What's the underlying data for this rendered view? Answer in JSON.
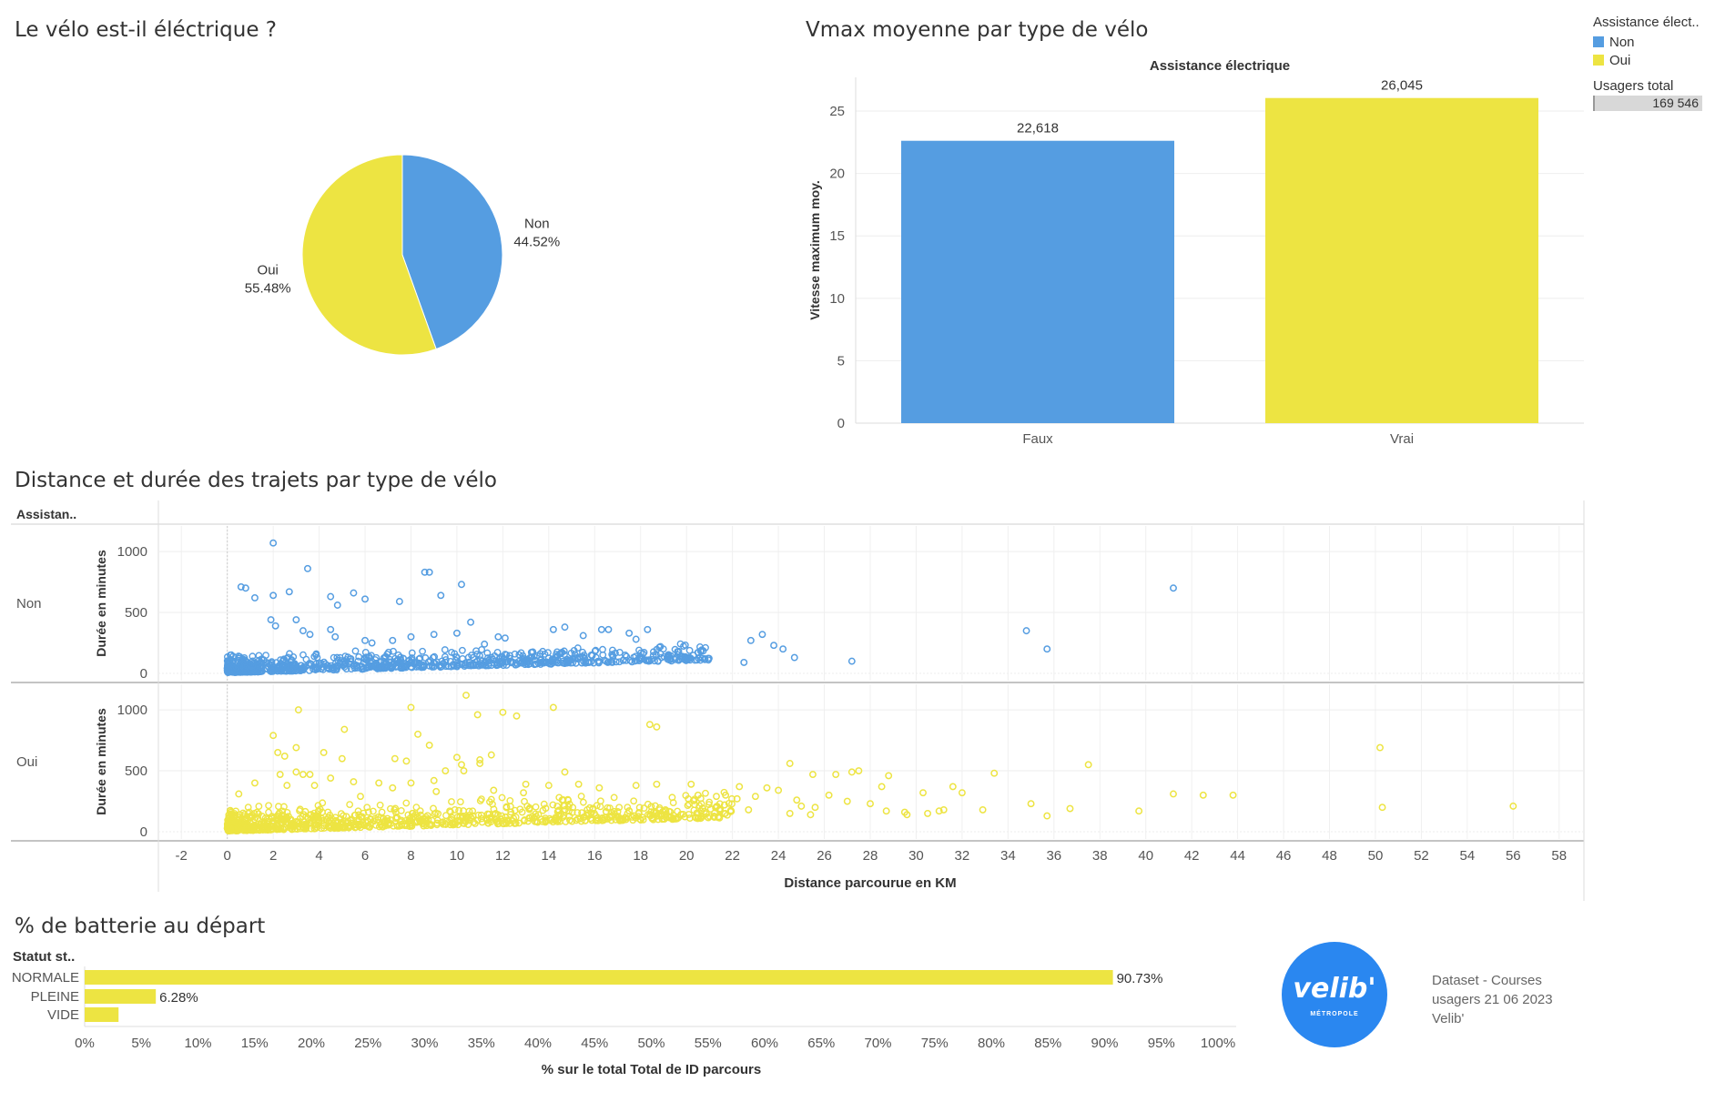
{
  "pie": {
    "title": "Le vélo est-il éléctrique ?",
    "chart_data": {
      "type": "pie",
      "slices": [
        {
          "label": "Non",
          "value": 44.52,
          "value_label": "44.52%",
          "color": "#559de1"
        },
        {
          "label": "Oui",
          "value": 55.48,
          "value_label": "55.48%",
          "color": "#ede442"
        }
      ]
    }
  },
  "vmax": {
    "title": "Vmax moyenne par type de vélo",
    "chart_data": {
      "type": "bar",
      "header": "Assistance électrique",
      "categories": [
        "Faux",
        "Vrai"
      ],
      "values": [
        22.618,
        26.045
      ],
      "value_labels": [
        "22,618",
        "26,045"
      ],
      "colors": [
        "#559de1",
        "#ede442"
      ],
      "ylabel": "Vitesse maximum moy.",
      "yticks": [
        "0",
        "5",
        "10",
        "15",
        "20",
        "25"
      ],
      "ylim": [
        0,
        27.7
      ]
    }
  },
  "legend": {
    "title": "Assistance élect..",
    "items": [
      {
        "label": "Non",
        "color": "#559de1"
      },
      {
        "label": "Oui",
        "color": "#ede442"
      }
    ],
    "total_title": "Usagers total",
    "total_value": "169 546"
  },
  "scatter": {
    "title": "Distance et durée des trajets par type de vélo",
    "chart_data": {
      "type": "scatter",
      "row_header": "Assistan..",
      "xlabel": "Distance parcourue en KM",
      "ylabel": "Durée en minutes",
      "xticks": [
        "-2",
        "0",
        "2",
        "4",
        "6",
        "8",
        "10",
        "12",
        "14",
        "16",
        "18",
        "20",
        "22",
        "24",
        "26",
        "28",
        "30",
        "32",
        "34",
        "36",
        "38",
        "40",
        "42",
        "44",
        "46",
        "48",
        "50",
        "52",
        "54",
        "56",
        "58"
      ],
      "yticks": [
        "0",
        "500",
        "1000"
      ],
      "xlim": [
        -3,
        59
      ],
      "ylim": [
        -30,
        1150
      ],
      "series": [
        {
          "name": "Non",
          "color": "#559de1",
          "points": [
            [
              2,
              1070
            ],
            [
              3.5,
              860
            ],
            [
              8.6,
              830
            ],
            [
              8.8,
              830
            ],
            [
              10.2,
              730
            ],
            [
              0.6,
              710
            ],
            [
              0.8,
              700
            ],
            [
              1.2,
              620
            ],
            [
              2,
              640
            ],
            [
              2.7,
              670
            ],
            [
              4.5,
              630
            ],
            [
              5.5,
              660
            ],
            [
              6,
              610
            ],
            [
              7.5,
              590
            ],
            [
              9.3,
              640
            ],
            [
              4.8,
              560
            ],
            [
              1.9,
              440
            ],
            [
              2.1,
              390
            ],
            [
              3,
              440
            ],
            [
              3.3,
              350
            ],
            [
              3.6,
              320
            ],
            [
              4.5,
              360
            ],
            [
              4.7,
              300
            ],
            [
              6,
              270
            ],
            [
              6.3,
              250
            ],
            [
              7.2,
              270
            ],
            [
              8,
              300
            ],
            [
              9,
              320
            ],
            [
              10,
              330
            ],
            [
              10.6,
              420
            ],
            [
              11.2,
              240
            ],
            [
              11.8,
              300
            ],
            [
              12.1,
              290
            ],
            [
              14.2,
              360
            ],
            [
              14.7,
              380
            ],
            [
              15.5,
              310
            ],
            [
              16.3,
              360
            ],
            [
              16.6,
              360
            ],
            [
              17.5,
              330
            ],
            [
              17.8,
              280
            ],
            [
              18.3,
              360
            ],
            [
              18.1,
              160
            ],
            [
              19.2,
              150
            ],
            [
              19.8,
              120
            ],
            [
              20,
              120
            ],
            [
              20.8,
              120
            ],
            [
              22.5,
              90
            ],
            [
              22.8,
              270
            ],
            [
              23.3,
              320
            ],
            [
              23.8,
              230
            ],
            [
              24.2,
              200
            ],
            [
              24.7,
              130
            ],
            [
              27.2,
              100
            ],
            [
              34.8,
              350
            ],
            [
              35.7,
              200
            ],
            [
              41.2,
              700
            ]
          ]
        },
        {
          "name": "Oui",
          "color": "#ede442",
          "points": [
            [
              10.4,
              1120
            ],
            [
              8,
              1020
            ],
            [
              14.2,
              1020
            ],
            [
              3.1,
              1000
            ],
            [
              10.9,
              960
            ],
            [
              12,
              980
            ],
            [
              12.6,
              950
            ],
            [
              2,
              790
            ],
            [
              5.1,
              840
            ],
            [
              8.3,
              800
            ],
            [
              18.4,
              880
            ],
            [
              18.7,
              860
            ],
            [
              8.8,
              710
            ],
            [
              3,
              690
            ],
            [
              2.2,
              650
            ],
            [
              2.5,
              620
            ],
            [
              4.2,
              650
            ],
            [
              5,
              600
            ],
            [
              7.3,
              600
            ],
            [
              7.8,
              580
            ],
            [
              10,
              610
            ],
            [
              11,
              560
            ],
            [
              11,
              590
            ],
            [
              11.5,
              630
            ],
            [
              10.2,
              550
            ],
            [
              2.3,
              470
            ],
            [
              3,
              490
            ],
            [
              3.3,
              470
            ],
            [
              3.6,
              470
            ],
            [
              4.5,
              440
            ],
            [
              5.5,
              410
            ],
            [
              6.6,
              400
            ],
            [
              7.2,
              360
            ],
            [
              8,
              400
            ],
            [
              9,
              420
            ],
            [
              9.5,
              500
            ],
            [
              10.3,
              500
            ],
            [
              14.7,
              490
            ],
            [
              1.2,
              400
            ],
            [
              2.6,
              380
            ],
            [
              3.8,
              380
            ],
            [
              9.1,
              330
            ],
            [
              11.6,
              340
            ],
            [
              13,
              390
            ],
            [
              14,
              380
            ],
            [
              15.3,
              390
            ],
            [
              16.2,
              360
            ],
            [
              17.8,
              380
            ],
            [
              18.7,
              390
            ],
            [
              20.2,
              390
            ],
            [
              20.5,
              300
            ],
            [
              21.3,
              290
            ],
            [
              22.3,
              370
            ],
            [
              23.5,
              360
            ],
            [
              24,
              340
            ],
            [
              24.5,
              560
            ],
            [
              25.5,
              470
            ],
            [
              26.5,
              470
            ],
            [
              27.2,
              490
            ],
            [
              27.5,
              500
            ],
            [
              28.5,
              370
            ],
            [
              28.8,
              460
            ],
            [
              30.3,
              320
            ],
            [
              31.6,
              370
            ],
            [
              32,
              320
            ],
            [
              31.2,
              180
            ],
            [
              33.4,
              480
            ],
            [
              32.9,
              180
            ],
            [
              35,
              230
            ],
            [
              35.7,
              130
            ],
            [
              36.7,
              190
            ],
            [
              37.5,
              550
            ],
            [
              39.7,
              170
            ],
            [
              41.2,
              310
            ],
            [
              42.5,
              300
            ],
            [
              43.8,
              300
            ],
            [
              50.2,
              690
            ],
            [
              50.3,
              200
            ],
            [
              56,
              210
            ],
            [
              0.5,
              310
            ],
            [
              5.8,
              290
            ],
            [
              12.9,
              320
            ],
            [
              21.7,
              300
            ],
            [
              22.2,
              270
            ],
            [
              23,
              290
            ],
            [
              24.8,
              260
            ],
            [
              25,
              210
            ],
            [
              25.6,
              200
            ],
            [
              26.2,
              300
            ],
            [
              27,
              250
            ],
            [
              28,
              230
            ],
            [
              28.7,
              170
            ],
            [
              29.5,
              160
            ],
            [
              29.6,
              140
            ],
            [
              30.5,
              150
            ],
            [
              31,
              170
            ],
            [
              25.4,
              140
            ],
            [
              22.7,
              180
            ],
            [
              24.5,
              150
            ]
          ]
        }
      ]
    }
  },
  "battery": {
    "title": "% de batterie au départ",
    "chart_data": {
      "type": "bar",
      "orientation": "horizontal",
      "row_header": "Statut st..",
      "categories": [
        "NORMALE",
        "PLEINE",
        "VIDE"
      ],
      "values": [
        90.73,
        6.28,
        2.99
      ],
      "value_labels": [
        "90.73%",
        "6.28%",
        ""
      ],
      "color": "#ede442",
      "xlabel": "% sur le total Total de ID parcours",
      "xticks": [
        "0%",
        "5%",
        "10%",
        "15%",
        "20%",
        "25%",
        "30%",
        "35%",
        "40%",
        "45%",
        "50%",
        "55%",
        "60%",
        "65%",
        "70%",
        "75%",
        "80%",
        "85%",
        "90%",
        "95%",
        "100%"
      ],
      "xlim": [
        0,
        100
      ]
    }
  },
  "logo": {
    "text": "velib'",
    "sub": "MÉTROPOLE"
  },
  "credits": [
    "Dataset - Courses",
    "usagers 21 06 2023",
    "Velib'"
  ]
}
